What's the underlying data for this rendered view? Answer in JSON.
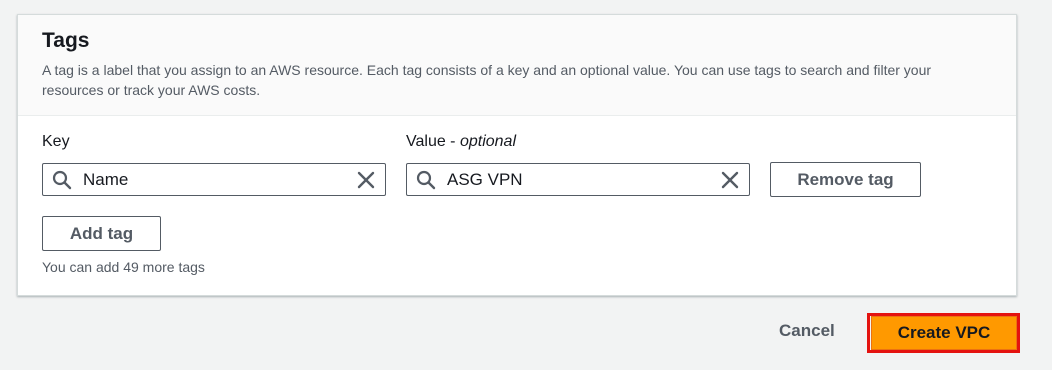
{
  "tags_section": {
    "title": "Tags",
    "description": "A tag is a label that you assign to an AWS resource. Each tag consists of a key and an optional value. You can use tags to search and filter your resources or track your AWS costs.",
    "key_label": "Key",
    "value_label": "Value - ",
    "value_label_optional": "optional",
    "tags": [
      {
        "key": "Name",
        "value": "ASG VPN"
      }
    ],
    "remove_tag_label": "Remove tag",
    "add_tag_label": "Add tag",
    "remaining_hint": "You can add 49 more tags"
  },
  "footer": {
    "cancel_label": "Cancel",
    "create_label": "Create VPC"
  },
  "colors": {
    "primary_button": "#ff9900",
    "highlight_outline": "#e4120f",
    "secondary_text": "#545b64"
  },
  "icons": {
    "search": "search-icon",
    "clear": "close-icon"
  }
}
